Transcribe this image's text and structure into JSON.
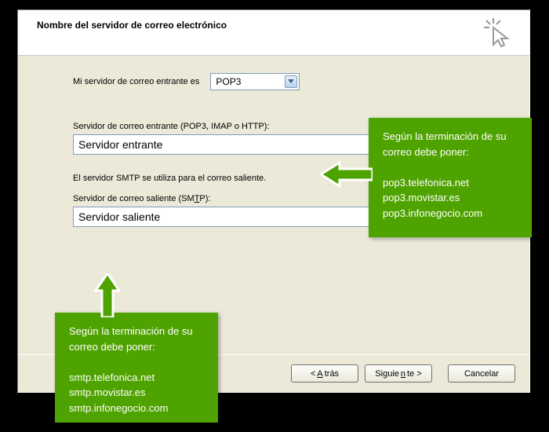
{
  "header": {
    "title": "Nombre del servidor de correo electrónico"
  },
  "body": {
    "incoming_type_label": "Mi servidor de correo entrante es",
    "incoming_type_value": "POP3",
    "incoming_label": "Servidor de correo entrante (POP3, IMAP o HTTP):",
    "incoming_value": "Servidor entrante",
    "smtp_note": "El servidor SMTP se utiliza para el correo saliente.",
    "outgoing_label_pre": "Servidor de correo saliente (SM",
    "outgoing_label_u": "T",
    "outgoing_label_post": "P):",
    "outgoing_value": "Servidor saliente"
  },
  "buttons": {
    "back_pre": "< ",
    "back_u": "A",
    "back_post": "trás",
    "next_pre": "Siguie",
    "next_u": "n",
    "next_post": "te >",
    "cancel": "Cancelar"
  },
  "popup_right": {
    "line1": "Según la terminación de su correo debe poner:",
    "opt1": "pop3.telefonica.net",
    "opt2": "pop3.movistar.es",
    "opt3": "pop3.infonegocio.com"
  },
  "popup_bottom": {
    "line1": "Según la terminación de su correo debe poner:",
    "opt1": "smtp.telefonica.net",
    "opt2": "smtp.movistar.es",
    "opt3": "smtp.infonegocio.com"
  }
}
